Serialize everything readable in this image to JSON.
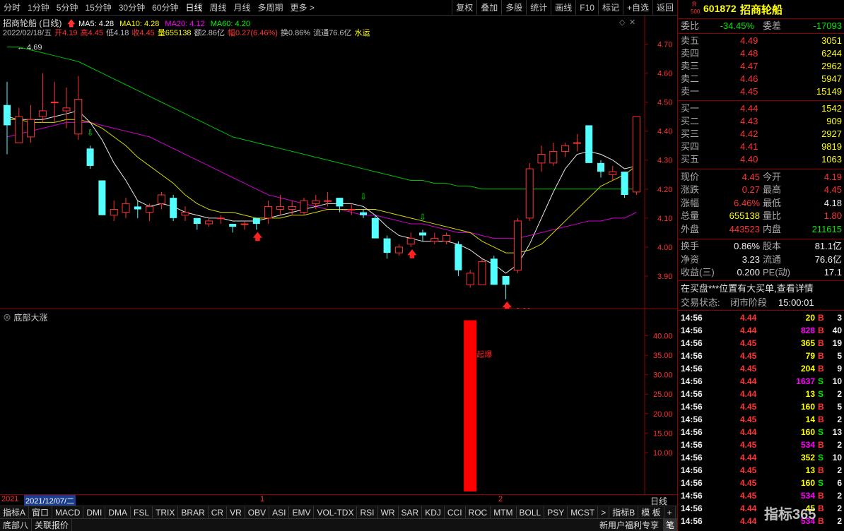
{
  "toolbar": {
    "left": [
      "分时",
      "1分钟",
      "5分钟",
      "15分钟",
      "30分钟",
      "60分钟",
      "日线",
      "周线",
      "月线",
      "多周期",
      "更多 >"
    ],
    "active": "日线",
    "right": [
      "复权",
      "叠加",
      "多股",
      "统计",
      "画线",
      "F10",
      "标记",
      "+自选",
      "返回"
    ]
  },
  "main": {
    "title": "招商轮船 (日线)",
    "ma": [
      {
        "label": "MA5: 4.28",
        "color": "#ffffff"
      },
      {
        "label": "MA10: 4.28",
        "color": "#ffff00"
      },
      {
        "label": "MA20: 4.12",
        "color": "#ff00ff"
      },
      {
        "label": "MA60: 4.20",
        "color": "#00ff00"
      }
    ],
    "info": [
      {
        "t": "2022/02/18/五",
        "c": "#c0c0c0"
      },
      {
        "t": "开4.19",
        "c": "#ff3333"
      },
      {
        "t": "高4.45",
        "c": "#ff3333"
      },
      {
        "t": "低4.18",
        "c": "#c0c0c0"
      },
      {
        "t": "收4.45",
        "c": "#ff3333"
      },
      {
        "t": "量655138",
        "c": "#ffff00"
      },
      {
        "t": "额2.86亿",
        "c": "#c0c0c0"
      },
      {
        "t": "幅0.27(6.46%)",
        "c": "#ff3333"
      },
      {
        "t": "换0.86%",
        "c": "#c0c0c0"
      },
      {
        "t": "流通76.6亿",
        "c": "#c0c0c0"
      },
      {
        "t": "水运",
        "c": "#ffff00"
      }
    ],
    "y_ticks": [
      "4.70",
      "4.60",
      "4.50",
      "4.40",
      "4.30",
      "4.20",
      "4.10",
      "4.00",
      "3.90"
    ],
    "high_label": "4.69",
    "low_label": "3.82"
  },
  "chart_data": {
    "type": "candlestick",
    "candles": [
      [
        4.49,
        4.42,
        4.57,
        4.32
      ],
      [
        4.36,
        4.45,
        4.48,
        4.36
      ],
      [
        4.38,
        4.44,
        4.49,
        4.36
      ],
      [
        4.45,
        4.47,
        4.6,
        4.43
      ],
      [
        4.5,
        4.5,
        4.57,
        4.43
      ],
      [
        4.47,
        4.48,
        4.55,
        4.41
      ],
      [
        4.39,
        4.51,
        4.59,
        4.37
      ],
      [
        4.34,
        4.28,
        4.35,
        4.27
      ],
      [
        4.23,
        4.11,
        4.23,
        4.11
      ],
      [
        4.11,
        4.13,
        4.16,
        4.09
      ],
      [
        4.12,
        4.15,
        4.17,
        4.1
      ],
      [
        4.14,
        4.13,
        4.16,
        4.1
      ],
      [
        4.12,
        4.14,
        4.15,
        4.09
      ],
      [
        4.15,
        4.18,
        4.19,
        4.13
      ],
      [
        4.17,
        4.1,
        4.18,
        4.09
      ],
      [
        4.11,
        4.12,
        4.14,
        4.09
      ],
      [
        4.1,
        4.08,
        4.1,
        4.06
      ],
      [
        4.08,
        4.09,
        4.1,
        4.07
      ],
      [
        4.1,
        4.1,
        4.11,
        4.08
      ],
      [
        4.08,
        4.07,
        4.08,
        4.05
      ],
      [
        4.08,
        4.08,
        4.09,
        4.06
      ],
      [
        4.1,
        4.08,
        4.1,
        4.06
      ],
      [
        4.1,
        4.14,
        4.16,
        4.08
      ],
      [
        4.13,
        4.14,
        4.18,
        4.11
      ],
      [
        4.13,
        4.14,
        4.16,
        4.11
      ],
      [
        4.12,
        4.16,
        4.17,
        4.11
      ],
      [
        4.15,
        4.16,
        4.18,
        4.13
      ],
      [
        4.16,
        4.16,
        4.19,
        4.14
      ],
      [
        4.17,
        4.14,
        4.17,
        4.12
      ],
      [
        4.13,
        4.13,
        4.15,
        4.11
      ],
      [
        4.12,
        4.11,
        4.13,
        4.1
      ],
      [
        4.1,
        4.03,
        4.11,
        4.03
      ],
      [
        4.03,
        3.98,
        4.04,
        3.96
      ],
      [
        3.98,
        4.0,
        4.01,
        3.97
      ],
      [
        4.01,
        4.03,
        4.05,
        4.0
      ],
      [
        4.05,
        4.04,
        4.06,
        4.02
      ],
      [
        4.02,
        4.03,
        4.05,
        4.01
      ],
      [
        4.02,
        4.04,
        4.05,
        4.01
      ],
      [
        4.01,
        3.92,
        4.02,
        3.9
      ],
      [
        3.87,
        3.91,
        3.92,
        3.86
      ],
      [
        3.87,
        3.95,
        3.96,
        3.87
      ],
      [
        3.96,
        3.87,
        3.97,
        3.87
      ],
      [
        3.9,
        3.87,
        3.9,
        3.82
      ],
      [
        3.92,
        4.09,
        4.1,
        3.91
      ],
      [
        4.1,
        4.27,
        4.29,
        4.09
      ],
      [
        4.29,
        4.32,
        4.35,
        4.26
      ],
      [
        4.29,
        4.33,
        4.36,
        4.28
      ],
      [
        4.33,
        4.35,
        4.36,
        4.31
      ],
      [
        4.36,
        4.36,
        4.39,
        4.33
      ],
      [
        4.42,
        4.29,
        4.42,
        4.29
      ],
      [
        4.29,
        4.26,
        4.3,
        4.24
      ],
      [
        4.25,
        4.26,
        4.28,
        4.23
      ],
      [
        4.26,
        4.18,
        4.26,
        4.17
      ],
      [
        4.19,
        4.45,
        4.45,
        4.18
      ]
    ],
    "y_range": [
      3.8,
      4.75
    ],
    "ma5": [
      4.45,
      4.44,
      4.44,
      4.44,
      4.45,
      4.46,
      4.47,
      4.43,
      4.37,
      4.29,
      4.23,
      4.16,
      4.14,
      4.15,
      4.14,
      4.12,
      4.11,
      4.1,
      4.1,
      4.09,
      4.09,
      4.09,
      4.1,
      4.11,
      4.12,
      4.13,
      4.14,
      4.15,
      4.15,
      4.15,
      4.14,
      4.11,
      4.07,
      4.04,
      4.03,
      4.02,
      4.02,
      4.02,
      4.01,
      3.99,
      3.96,
      3.94,
      3.91,
      3.94,
      4.01,
      4.1,
      4.19,
      4.27,
      4.32,
      4.33,
      4.32,
      4.3,
      4.27,
      4.28
    ],
    "ma10": [
      4.44,
      4.44,
      4.43,
      4.43,
      4.43,
      4.44,
      4.44,
      4.43,
      4.41,
      4.38,
      4.35,
      4.31,
      4.28,
      4.25,
      4.22,
      4.18,
      4.15,
      4.13,
      4.12,
      4.12,
      4.11,
      4.1,
      4.1,
      4.1,
      4.11,
      4.11,
      4.12,
      4.13,
      4.13,
      4.13,
      4.13,
      4.13,
      4.12,
      4.11,
      4.1,
      4.09,
      4.08,
      4.07,
      4.06,
      4.05,
      4.02,
      4.0,
      3.98,
      3.98,
      3.99,
      4.01,
      4.05,
      4.09,
      4.13,
      4.17,
      4.21,
      4.23,
      4.25,
      4.28
    ],
    "ma20": [
      4.38,
      4.39,
      4.4,
      4.41,
      4.42,
      4.43,
      4.43,
      4.43,
      4.42,
      4.41,
      4.4,
      4.39,
      4.38,
      4.36,
      4.34,
      4.32,
      4.3,
      4.28,
      4.26,
      4.24,
      4.22,
      4.2,
      4.18,
      4.17,
      4.16,
      4.15,
      4.14,
      4.13,
      4.13,
      4.12,
      4.11,
      4.11,
      4.1,
      4.09,
      4.08,
      4.08,
      4.07,
      4.06,
      4.05,
      4.05,
      4.04,
      4.03,
      4.03,
      4.03,
      4.04,
      4.05,
      4.06,
      4.07,
      4.08,
      4.09,
      4.09,
      4.1,
      4.1,
      4.12
    ],
    "ma60": [
      4.69,
      4.69,
      4.68,
      4.67,
      4.66,
      4.65,
      4.64,
      4.62,
      4.6,
      4.58,
      4.56,
      4.54,
      4.52,
      4.5,
      4.48,
      4.46,
      4.44,
      4.42,
      4.4,
      4.38,
      4.37,
      4.36,
      4.35,
      4.34,
      4.33,
      4.32,
      4.31,
      4.3,
      4.29,
      4.28,
      4.27,
      4.26,
      4.25,
      4.24,
      4.23,
      4.23,
      4.22,
      4.22,
      4.21,
      4.21,
      4.2,
      4.2,
      4.2,
      4.2,
      4.2,
      4.2,
      4.2,
      4.2,
      4.2,
      4.2,
      4.2,
      4.2,
      4.2,
      4.2
    ],
    "down_arrows": [
      7,
      30,
      35
    ],
    "up_arrows": [
      21,
      34,
      42
    ]
  },
  "indicator": {
    "title": "底部大涨",
    "y_ticks": [
      "40.00",
      "35.00",
      "30.00",
      "25.00",
      "20.00",
      "15.00",
      "10.00"
    ],
    "y_range": [
      0,
      45
    ],
    "bar_index": 39,
    "bar_value": 44,
    "bar_label": "起爆"
  },
  "date_axis": {
    "start": "2021",
    "cursor": "2021/12/07/二",
    "m1": "1",
    "m2": "2",
    "right": "日线"
  },
  "tabs": [
    "指标A",
    "窗口",
    "MACD",
    "DMI",
    "DMA",
    "FSL",
    "TRIX",
    "BRAR",
    "CR",
    "VR",
    "OBV",
    "ASI",
    "EMV",
    "VOL-TDX",
    "RSI",
    "WR",
    "SAR",
    "KDJ",
    "CCI",
    "ROC",
    "MTM",
    "BOLL",
    "PSY",
    "MCST",
    ">"
  ],
  "tabs_right": [
    "指标B",
    "模 板",
    "+",
    "−"
  ],
  "status": {
    "left": [
      "底部八",
      "关联报价"
    ],
    "right": "新用户福利专享",
    "corner": "笔"
  },
  "side": {
    "code": "601872",
    "name": "招商轮船",
    "r_label": "R",
    "r_num": "500",
    "webi": {
      "l": "委比",
      "v": "-34.45%",
      "l2": "委差",
      "v2": "-17093"
    },
    "sells": [
      {
        "l": "卖五",
        "p": "4.49",
        "v": "3051"
      },
      {
        "l": "卖四",
        "p": "4.48",
        "v": "6244"
      },
      {
        "l": "卖三",
        "p": "4.47",
        "v": "2962"
      },
      {
        "l": "卖二",
        "p": "4.46",
        "v": "5947"
      },
      {
        "l": "卖一",
        "p": "4.45",
        "v": "15149"
      }
    ],
    "buys": [
      {
        "l": "买一",
        "p": "4.44",
        "v": "1542"
      },
      {
        "l": "买二",
        "p": "4.43",
        "v": "909"
      },
      {
        "l": "买三",
        "p": "4.42",
        "v": "2927"
      },
      {
        "l": "买四",
        "p": "4.41",
        "v": "9819"
      },
      {
        "l": "买五",
        "p": "4.40",
        "v": "1063"
      }
    ],
    "quote": [
      {
        "l": "现价",
        "v": "4.45",
        "c": "red",
        "l2": "今开",
        "v2": "4.19",
        "c2": "red"
      },
      {
        "l": "涨跌",
        "v": "0.27",
        "c": "red",
        "l2": "最高",
        "v2": "4.45",
        "c2": "red"
      },
      {
        "l": "涨幅",
        "v": "6.46%",
        "c": "red",
        "l2": "最低",
        "v2": "4.18",
        "c2": "white"
      },
      {
        "l": "总量",
        "v": "655138",
        "c": "yellow",
        "l2": "量比",
        "v2": "1.80",
        "c2": "red"
      },
      {
        "l": "外盘",
        "v": "443523",
        "c": "red",
        "l2": "内盘",
        "v2": "211615",
        "c2": "green"
      }
    ],
    "fund": [
      {
        "l": "换手",
        "v": "0.86%",
        "l2": "股本",
        "v2": "81.1亿"
      },
      {
        "l": "净资",
        "v": "3.23",
        "l2": "流通",
        "v2": "76.6亿"
      },
      {
        "l": "收益(三)",
        "v": "0.200",
        "l2": "PE(动)",
        "v2": "17.1"
      }
    ],
    "notice": "在买盘***位置有大买单,查看详情",
    "state": {
      "l": "交易状态:",
      "v": "闭市阶段",
      "t": "15:00:01"
    },
    "ticks": [
      {
        "t": "14:56",
        "p": "4.44",
        "v": "20",
        "s": "B",
        "n": "3",
        "vc": "yellow"
      },
      {
        "t": "14:56",
        "p": "4.44",
        "v": "828",
        "s": "B",
        "n": "40",
        "vc": "magenta"
      },
      {
        "t": "14:56",
        "p": "4.45",
        "v": "365",
        "s": "B",
        "n": "19",
        "vc": "yellow"
      },
      {
        "t": "14:56",
        "p": "4.45",
        "v": "79",
        "s": "B",
        "n": "5",
        "vc": "yellow"
      },
      {
        "t": "14:56",
        "p": "4.45",
        "v": "204",
        "s": "B",
        "n": "9",
        "vc": "yellow"
      },
      {
        "t": "14:56",
        "p": "4.44",
        "v": "1637",
        "s": "S",
        "n": "10",
        "vc": "magenta"
      },
      {
        "t": "14:56",
        "p": "4.44",
        "v": "13",
        "s": "S",
        "n": "2",
        "vc": "yellow"
      },
      {
        "t": "14:56",
        "p": "4.45",
        "v": "160",
        "s": "B",
        "n": "5",
        "vc": "yellow"
      },
      {
        "t": "14:56",
        "p": "4.45",
        "v": "14",
        "s": "B",
        "n": "2",
        "vc": "yellow"
      },
      {
        "t": "14:56",
        "p": "4.44",
        "v": "160",
        "s": "S",
        "n": "13",
        "vc": "yellow"
      },
      {
        "t": "14:56",
        "p": "4.45",
        "v": "534",
        "s": "B",
        "n": "2",
        "vc": "magenta"
      },
      {
        "t": "14:56",
        "p": "4.44",
        "v": "352",
        "s": "S",
        "n": "10",
        "vc": "yellow"
      },
      {
        "t": "14:56",
        "p": "4.45",
        "v": "13",
        "s": "B",
        "n": "2",
        "vc": "yellow"
      },
      {
        "t": "14:56",
        "p": "4.45",
        "v": "160",
        "s": "S",
        "n": "6",
        "vc": "yellow"
      },
      {
        "t": "14:56",
        "p": "4.45",
        "v": "534",
        "s": "B",
        "n": "2",
        "vc": "magenta"
      },
      {
        "t": "14:56",
        "p": "4.44",
        "v": "45",
        "s": "B",
        "n": "2",
        "vc": "yellow"
      },
      {
        "t": "14:56",
        "p": "4.44",
        "v": "534",
        "s": "B",
        "n": "2",
        "vc": "magenta"
      }
    ],
    "watermark": "指标365"
  }
}
